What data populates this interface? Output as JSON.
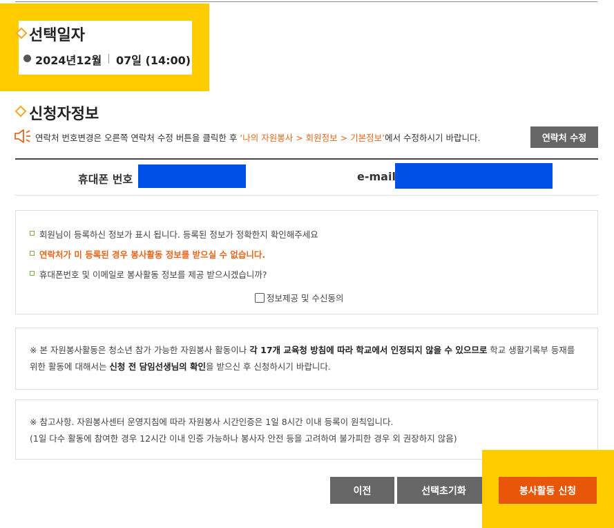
{
  "date_section": {
    "title": "선택일자",
    "year_month": "2024년12월",
    "day_time": "07일 (14:00)"
  },
  "applicant": {
    "title": "신청자정보",
    "notice_prefix": "연락처 번호변경은 오른쪽 연락처 수정 버튼을 클릭한 후 ",
    "notice_path": "‘나의 자원봉사 > 회원정보 > 기본정보’",
    "notice_suffix": "에서 수정하시기 바랍니다.",
    "edit_button": "연락처 수정",
    "phone_label": "휴대폰 번호",
    "email_label": "e-mail"
  },
  "info_box": {
    "line1": "회원님이 등록하신 정보가 표시 됩니다. 등록된 정보가 정확한지 확인해주세요",
    "line2": "연락처가 미 등록된 경우 봉사활동 정보를 받으실 수 없습니다.",
    "line3": "휴대폰번호 및 이메일로 봉사활동 정보를 제공 받으시겠습니까?",
    "consent_label": "정보제공 및 수신동의",
    "consent_checked": false
  },
  "notice_box": {
    "p1": "※ 본 자원봉사활동은 청소년 참가 가능한 자원봉사 활동이나 ",
    "p1_bold": "각 17개 교육청 방침에 따라 학교에서 인정되지 않을 수 있으므로",
    "p2": " 학교 생활기록부 등재를 위한 활동에 대해서는 ",
    "p2_bold": "신청 전 담임선생님의 확인",
    "p3": "을 받으신 후 신청하시기 바랍니다."
  },
  "reference_box": {
    "line1": "※ 참고사항. 자원봉사센터 운영지침에 따라 자원봉사 시간인증은 1일 8시간 이내 등록이 원칙입니다.",
    "line2": "(1일 다수 활동에 참여한 경우 12시간 이내 인증 가능하나 봉사자 안전 등을 고려하여 불가피한 경우 외 권장하지 않음)"
  },
  "buttons": {
    "prev": "이전",
    "reset": "선택초기화",
    "apply": "봉사활동 신청"
  },
  "colors": {
    "highlight": "#ffcc00",
    "accent": "#e8661c",
    "apply_button": "#e8560a",
    "redaction": "#0050e8"
  }
}
